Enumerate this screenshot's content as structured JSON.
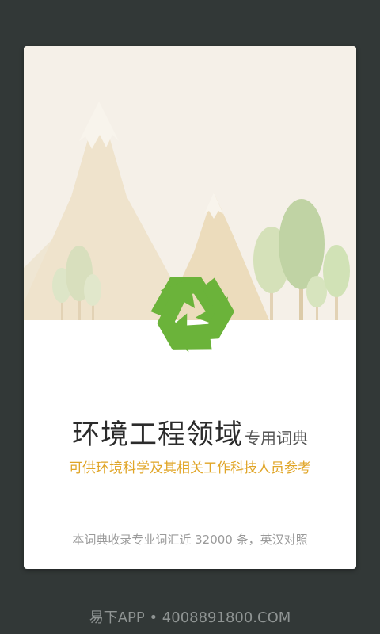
{
  "splash": {
    "title_main": "环境工程领域",
    "title_sub": "专用词典",
    "tagline": "可供环境科学及其相关工作科技人员参考",
    "info": "本词典收录专业词汇近 32000 条，英汉对照"
  },
  "footer": {
    "text": "易下APP • 4008891800.COM"
  },
  "icons": {
    "logo": "recycle-icon"
  },
  "colors": {
    "background": "#323837",
    "card": "#ffffff",
    "sky": "#f5f0e8",
    "recycle_green": "#6bb33a",
    "tagline": "#e0a527"
  }
}
